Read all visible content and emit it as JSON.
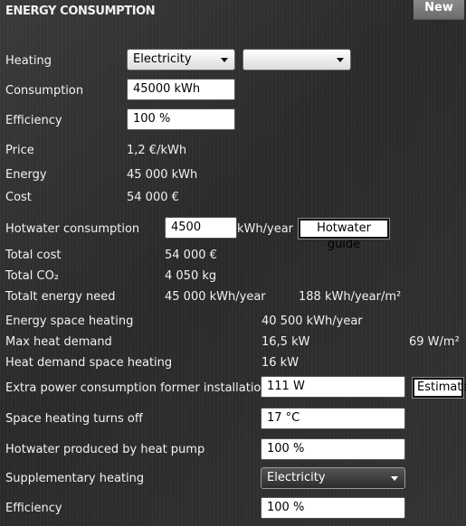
{
  "header": {
    "title": "ENERGY CONSUMPTION",
    "new_button": "New"
  },
  "heating": {
    "label": "Heating",
    "select_value": "Electricity",
    "select2_value": ""
  },
  "consumption": {
    "label": "Consumption",
    "value": "45000 kWh"
  },
  "efficiency": {
    "label": "Efficiency",
    "value": "100 %"
  },
  "price": {
    "label": "Price",
    "value": "1,2 €/kWh"
  },
  "energy": {
    "label": "Energy",
    "value": "45 000 kWh"
  },
  "cost": {
    "label": "Cost",
    "value": "54 000 €"
  },
  "hotwater": {
    "label": "Hotwater consumption",
    "value": "4500",
    "unit": "kWh/year",
    "guide_button": "Hotwater guide"
  },
  "totals": {
    "total_cost_label": "Total cost",
    "total_cost": "54 000 €",
    "total_co2_label": "Total CO₂",
    "total_co2": "4 050 kg",
    "total_energy_label": "Totalt energy need",
    "total_energy": "45 000 kWh/year",
    "total_energy_per_m2": "188 kWh/year/m²"
  },
  "space": {
    "energy_label": "Energy space heating",
    "energy_value": "40 500 kWh/year",
    "max_heat_label": "Max heat demand",
    "max_heat_value": "16,5 kW",
    "max_heat_per_m2": "69 W/m²",
    "heat_demand_label": "Heat demand space heating",
    "heat_demand_value": "16 kW"
  },
  "extra_power": {
    "label": "Extra power consumption former installation",
    "value": "111 W",
    "estimate_button": "Estimate"
  },
  "turns_off": {
    "label": "Space heating turns off",
    "value": "17 °C"
  },
  "heat_pump": {
    "label": "Hotwater produced by heat pump",
    "value": "100 %"
  },
  "supplementary": {
    "label": "Supplementary heating",
    "select_value": "Electricity"
  },
  "efficiency2": {
    "label": "Efficiency",
    "value": "100 %"
  }
}
